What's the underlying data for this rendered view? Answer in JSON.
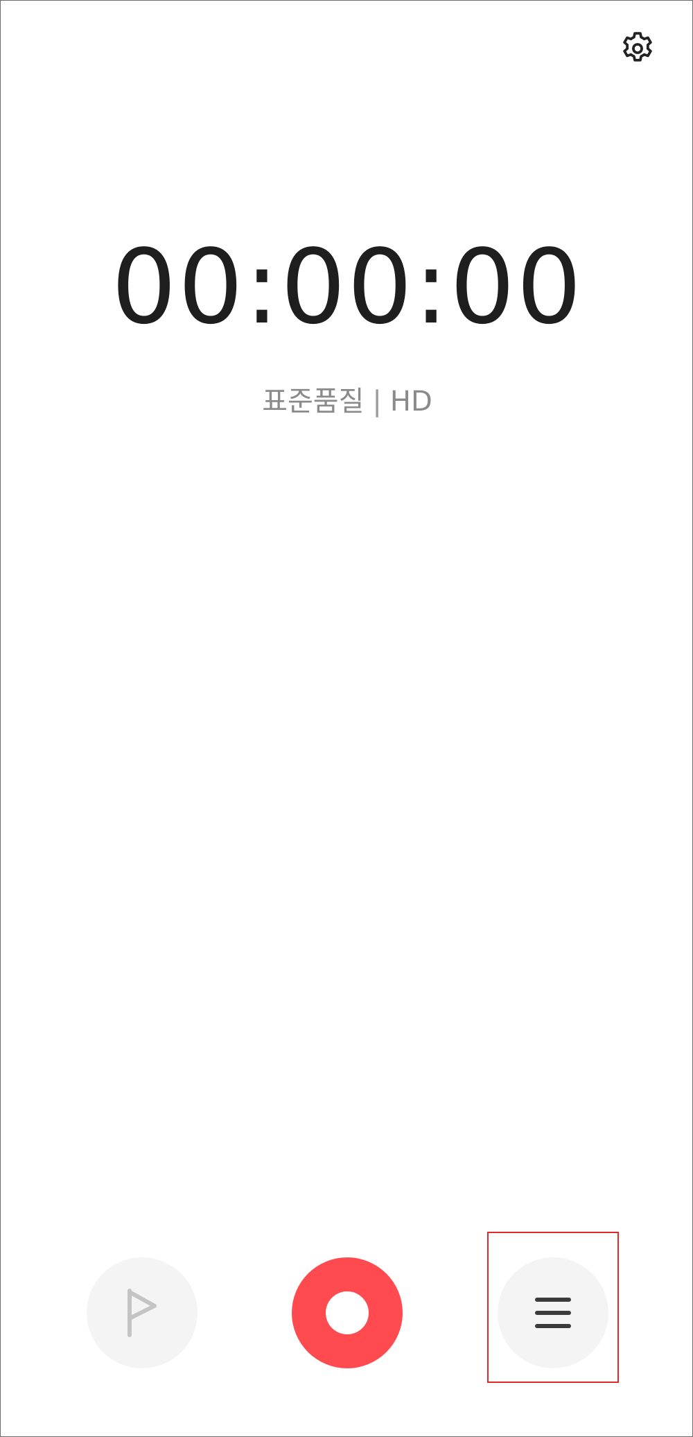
{
  "header": {
    "settings_icon": "gear-icon"
  },
  "recorder": {
    "timer": "00:00:00",
    "quality_label": "표준품질",
    "quality_separator": "|",
    "quality_format": "HD"
  },
  "controls": {
    "flag_icon": "flag-icon",
    "record_icon": "record-icon",
    "list_icon": "list-icon"
  },
  "colors": {
    "record_accent": "#ff4a4f",
    "timer_text": "#1e1e1e",
    "secondary_text": "#8a8a8a",
    "button_bg": "#f4f4f4",
    "highlight": "#e02a2a"
  }
}
